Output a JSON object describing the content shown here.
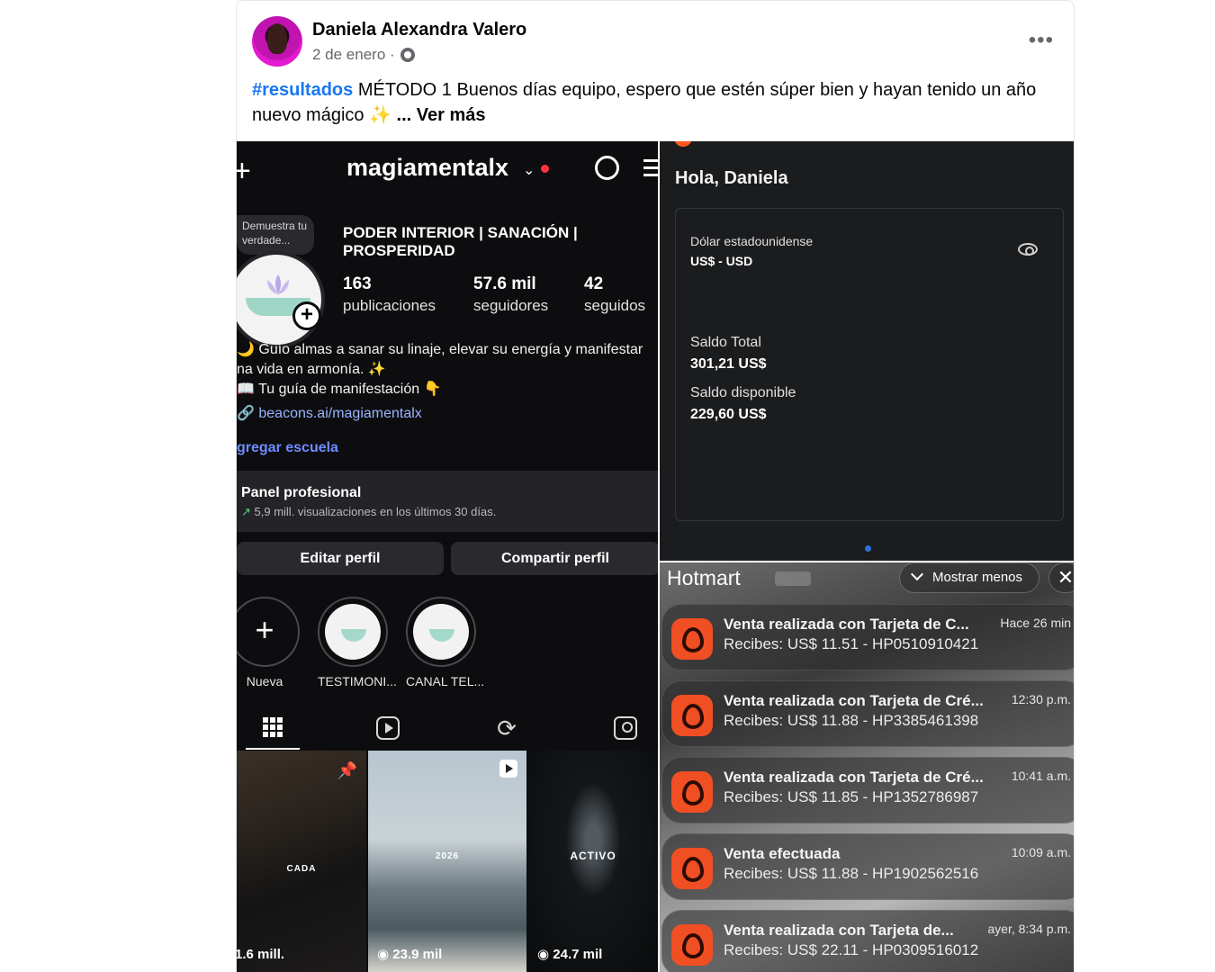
{
  "post": {
    "author": "Daniela Alexandra Valero",
    "date": "2 de enero · ",
    "more_label": "•••",
    "hashtag": "#resultados",
    "caption": " MÉTODO 1 Buenos días equipo, espero que estén súper bien y hayan tenido un año nuevo mágico ✨ ",
    "see_more": "... Ver más"
  },
  "instagram": {
    "username": "magiamentalx",
    "bubble": "Demuestra tu verdade...",
    "name": "PODER INTERIOR | SANACIÓN | PROSPERIDAD",
    "stats": [
      {
        "value": "163",
        "label": "publicaciones"
      },
      {
        "value": "57.6 mil",
        "label": "seguidores"
      },
      {
        "value": "42",
        "label": "seguidos"
      }
    ],
    "bio_line1": "🌙 Guío almas a sanar su linaje, elevar su energía y manifestar",
    "bio_line2": "na vida en armonía. ✨",
    "bio_line3": "📖 Tu guía de manifestación 👇",
    "link": "🔗 beacons.ai/magiamentalx",
    "add_school": "gregar escuela",
    "panel_title": "Panel profesional",
    "panel_arrow": "↗",
    "panel_sub": " 5,9 mill. visualizaciones en los últimos 30 días.",
    "edit_btn": "Editar perfil",
    "share_btn": "Compartir perfil",
    "highlights": [
      "Nueva",
      "TESTIMONI...",
      "CANAL TEL..."
    ],
    "posts": [
      {
        "label": "CADA",
        "views": "1.6 mill."
      },
      {
        "label": "2026",
        "views": "◉ 23.9 mil"
      },
      {
        "label": "ACTIVO",
        "views": "◉ 24.7 mil"
      }
    ]
  },
  "balance": {
    "greeting": "Hola, Daniela",
    "currency_name": "Dólar estadounidense",
    "currency_code": "US$ - USD",
    "total_label": "Saldo Total",
    "total_value": "301,21 US$",
    "available_label": "Saldo disponible",
    "available_value": "229,60 US$"
  },
  "hotmart": {
    "title": "Hotmart",
    "show_less": "Mostrar menos",
    "close": "✕",
    "notifications": [
      {
        "title": "Venta realizada con Tarjeta de C...",
        "body": "Recibes: US$ 11.51 - HP0510910421",
        "time": "Hace 26 min"
      },
      {
        "title": "Venta realizada con Tarjeta de Cré...",
        "body": "Recibes: US$ 11.88 - HP3385461398",
        "time": "12:30 p.m."
      },
      {
        "title": "Venta realizada con Tarjeta de Cré...",
        "body": "Recibes: US$ 11.85 - HP1352786987",
        "time": "10:41 a.m."
      },
      {
        "title": "Venta efectuada",
        "body": "Recibes: US$ 11.88 - HP1902562516",
        "time": "10:09 a.m."
      },
      {
        "title": "Venta realizada con Tarjeta de...",
        "body": "Recibes: US$ 22.11 - HP0309516012",
        "time": "ayer, 8:34 p.m."
      }
    ]
  }
}
